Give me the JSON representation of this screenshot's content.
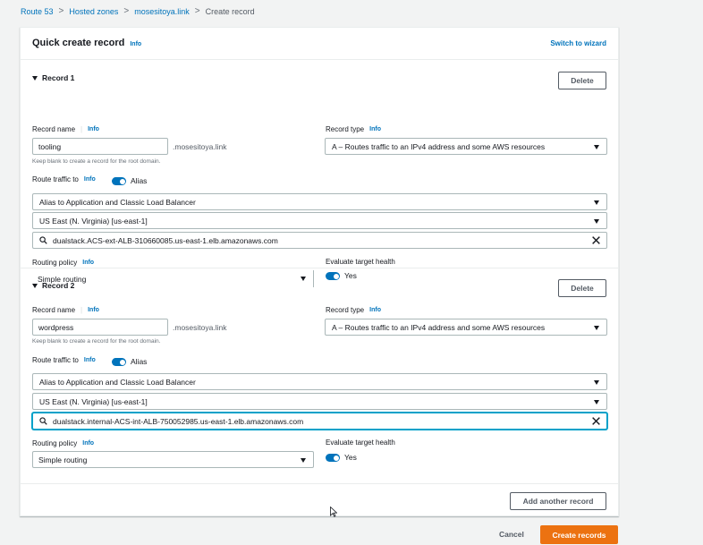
{
  "breadcrumb": {
    "items": [
      "Route 53",
      "Hosted zones",
      "mosesitoya.link"
    ],
    "current": "Create record",
    "separator": ">"
  },
  "header": {
    "title": "Quick create record",
    "info": "Info",
    "switch_link": "Switch to wizard"
  },
  "labels": {
    "record_name": "Record name",
    "record_type": "Record type",
    "info": "Info",
    "hint": "Keep blank to create a record for the root domain.",
    "route_traffic": "Route traffic to",
    "alias": "Alias",
    "routing_policy": "Routing policy",
    "evaluate_health": "Evaluate target health",
    "yes": "Yes",
    "delete": "Delete"
  },
  "records": [
    {
      "title": "Record 1",
      "name_value": "tooling",
      "domain_suffix": ".mosesitoya.link",
      "record_type": "A – Routes traffic to an IPv4 address and some AWS resources",
      "endpoint_type": "Alias to Application and Classic Load Balancer",
      "region": "US East (N. Virginia) [us-east-1]",
      "load_balancer": "dualstack.ACS-ext-ALB-310660085.us-east-1.elb.amazonaws.com",
      "routing_policy": "Simple routing",
      "alias_enabled": true,
      "health_enabled": true
    },
    {
      "title": "Record 2",
      "name_value": "wordpress",
      "domain_suffix": ".mosesitoya.link",
      "record_type": "A – Routes traffic to an IPv4 address and some AWS resources",
      "endpoint_type": "Alias to Application and Classic Load Balancer",
      "region": "US East (N. Virginia) [us-east-1]",
      "load_balancer": "dualstack.internal-ACS-int-ALB-750052985.us-east-1.elb.amazonaws.com",
      "routing_policy": "Simple routing",
      "alias_enabled": true,
      "health_enabled": true
    }
  ],
  "actions": {
    "add_record": "Add another record",
    "cancel": "Cancel",
    "create": "Create records"
  },
  "colors": {
    "link": "#0073bb",
    "primary": "#ec7211",
    "toggle_on": "#0073bb",
    "focus": "#00a1c9"
  }
}
